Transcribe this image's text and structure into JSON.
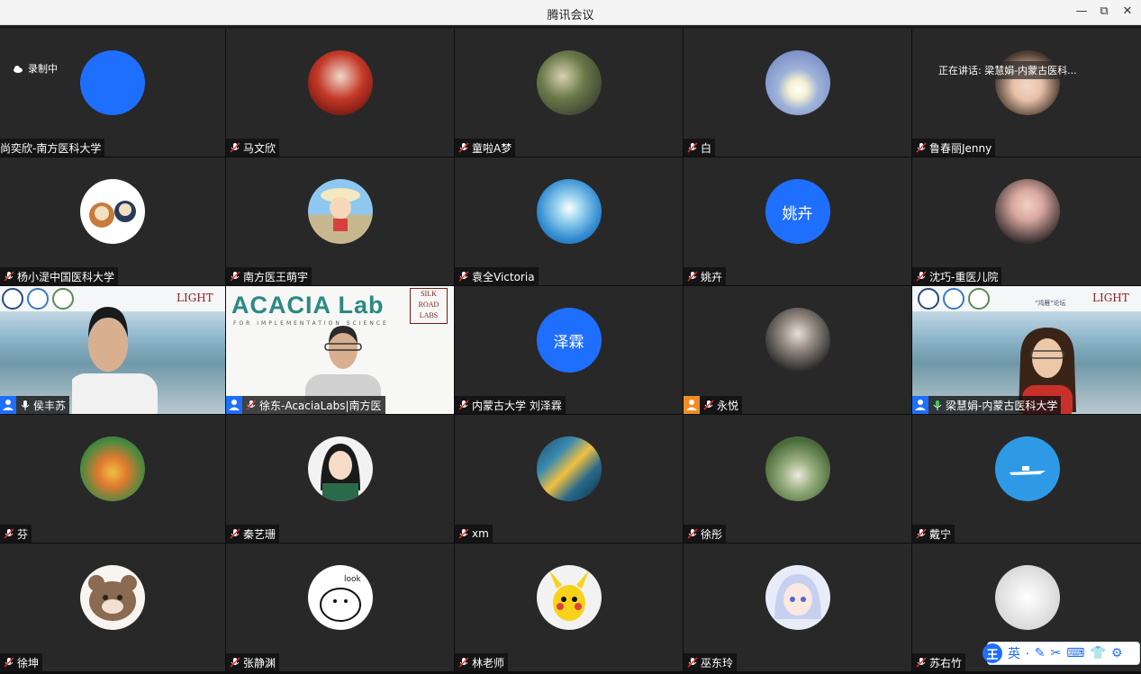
{
  "window": {
    "title": "腾讯会议",
    "minimize": "—",
    "restore": "⧉",
    "close": "✕"
  },
  "recording_label": "录制中",
  "speaking_label": "正在讲话: 梁慧娟-内蒙古医科...",
  "participants": [
    {
      "name": "尚奕欣-南方医科大学",
      "avatar": "blue-circle",
      "muted": false
    },
    {
      "name": "马文欣",
      "avatar": "photo"
    },
    {
      "name": "童啦A梦",
      "avatar": "photo"
    },
    {
      "name": "白",
      "avatar": "photo"
    },
    {
      "name": "鲁春丽Jenny",
      "avatar": "photo"
    },
    {
      "name": "杨小湜中国医科大学",
      "avatar": "cartoon"
    },
    {
      "name": "南方医王萌宇",
      "avatar": "cartoon"
    },
    {
      "name": "袁全Victoria",
      "avatar": "photo"
    },
    {
      "name": "姚卉",
      "avatar_text": "姚卉"
    },
    {
      "name": "沈巧-重医儿院",
      "avatar": "photo"
    },
    {
      "name": "侯丰苏",
      "video": true
    },
    {
      "name": "徐东-AcaciaLabs|南方医",
      "video": true
    },
    {
      "name": "内蒙古大学 刘泽霖",
      "avatar_text": "泽霖"
    },
    {
      "name": "永悦",
      "avatar": "photo"
    },
    {
      "name": "梁慧娟-内蒙古医科大学",
      "video": true
    },
    {
      "name": "芬",
      "avatar": "photo"
    },
    {
      "name": "秦艺珊",
      "avatar": "cartoon"
    },
    {
      "name": "xm",
      "avatar": "photo"
    },
    {
      "name": "徐彤",
      "avatar": "photo"
    },
    {
      "name": "戴宁",
      "avatar": "photo"
    },
    {
      "name": "徐坤",
      "avatar": "cartoon"
    },
    {
      "name": "张静渊",
      "avatar": "cartoon"
    },
    {
      "name": "林老师",
      "avatar": "cartoon"
    },
    {
      "name": "巫东玲",
      "avatar": "cartoon"
    },
    {
      "name": "苏右竹",
      "avatar": "photo"
    }
  ],
  "video_text": {
    "acacia_title": "ACACIA Lab",
    "acacia_sub": "FOR IMPLEMENTATION SCIENCE",
    "silk": "SILK ROAD LABS",
    "light": "LIGHT",
    "banner_small": "\"鸿雁\"论坛"
  },
  "ime": {
    "logo": "王",
    "lang": "英"
  },
  "colors": {
    "accent": "#1f6fff",
    "tile": "#282828",
    "nameplate": "#0f0f0f"
  }
}
